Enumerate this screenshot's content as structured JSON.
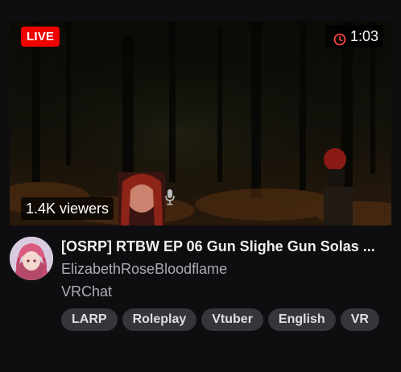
{
  "stream": {
    "live_label": "LIVE",
    "duration": "1:03",
    "viewers": "1.4K viewers",
    "title": "[OSRP] RTBW EP 06 Gun Slighe Gun Solas ...",
    "channel": "ElizabethRoseBloodflame",
    "category": "VRChat",
    "tags": [
      "LARP",
      "Roleplay",
      "Vtuber",
      "English",
      "VR"
    ]
  },
  "icons": {
    "duration": "clock-icon",
    "mic": "microphone-icon"
  },
  "colors": {
    "live_badge": "#eb0400",
    "background": "#0e0e10",
    "tag_bg": "#35353b",
    "secondary_text": "#adadb8"
  }
}
